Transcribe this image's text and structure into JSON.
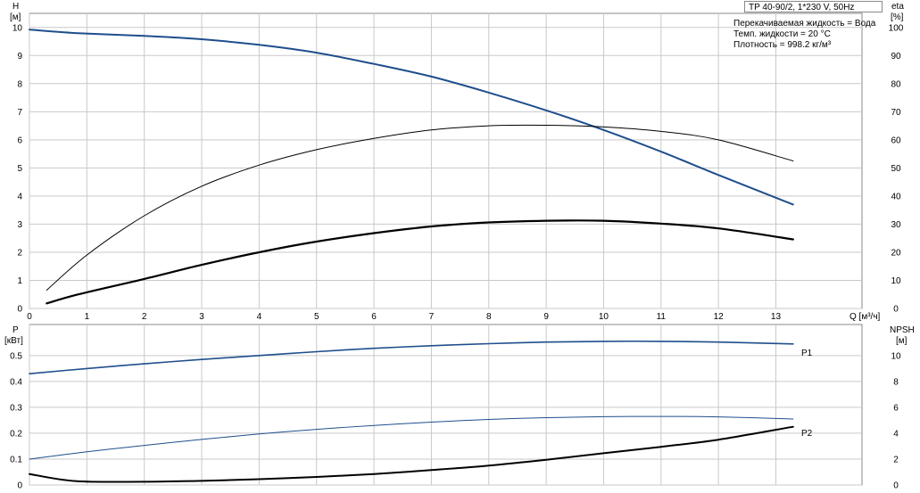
{
  "header": {
    "pump_model": "TP 40-90/2, 1*230 V, 50Hz",
    "info_lines": [
      "Перекачиваемая жидкость = Вода",
      "Темп. жидкости = 20 °C",
      "Плотность = 998.2 кг/м³"
    ]
  },
  "chart_data": [
    {
      "type": "line",
      "xlabel": "Q [м³/ч]",
      "xlim": [
        0,
        14.5
      ],
      "x_ticks": [
        0,
        1,
        2,
        3,
        4,
        5,
        6,
        7,
        8,
        9,
        10,
        11,
        12,
        13
      ],
      "left_axis": {
        "label_line1": "H",
        "label_line2": "[м]",
        "ylim": [
          0,
          10.5
        ],
        "ticks": [
          0,
          1,
          2,
          3,
          4,
          5,
          6,
          7,
          8,
          9,
          10
        ]
      },
      "right_axis": {
        "label_line1": "eta",
        "label_line2": "[%]",
        "ylim": [
          0,
          105
        ],
        "ticks": [
          0,
          10,
          20,
          30,
          40,
          50,
          60,
          70,
          80,
          90,
          100
        ]
      },
      "grid": true,
      "series": [
        {
          "id": "H",
          "axis": "left",
          "color": "#1f4e8c",
          "width": 2,
          "x": [
            0,
            0.8,
            2,
            3,
            4,
            5,
            6,
            7,
            8,
            9,
            10,
            11,
            12,
            13.3
          ],
          "y": [
            9.92,
            9.8,
            9.7,
            9.58,
            9.38,
            9.1,
            8.7,
            8.25,
            7.68,
            7.05,
            6.35,
            5.58,
            4.75,
            3.7
          ]
        },
        {
          "id": "eta_total",
          "axis": "right",
          "color": "#000000",
          "width": 1,
          "x": [
            0.3,
            1,
            2,
            3,
            4,
            5,
            6,
            7,
            8,
            9,
            10,
            11,
            12,
            13.3
          ],
          "y": [
            6.5,
            19,
            33,
            43.5,
            51,
            56.5,
            60.5,
            63.5,
            65,
            65.2,
            64.6,
            63,
            60,
            52.5
          ]
        },
        {
          "id": "eta_pump",
          "axis": "right",
          "color": "#000000",
          "width": 2.2,
          "x": [
            0.3,
            0.85,
            2,
            3,
            4,
            5,
            6,
            7,
            8,
            9,
            10,
            11,
            12,
            13.3
          ],
          "y": [
            1.8,
            5,
            10.5,
            15.5,
            20,
            23.8,
            26.8,
            29.2,
            30.6,
            31.2,
            31.2,
            30.2,
            28.5,
            24.6
          ]
        }
      ]
    },
    {
      "type": "line",
      "xlim": [
        0,
        14.5
      ],
      "left_axis": {
        "label_line1": "P",
        "label_line2": "[кВт]",
        "ylim": [
          0,
          0.62
        ],
        "ticks": [
          0,
          0.1,
          0.2,
          0.3,
          0.4,
          0.5
        ]
      },
      "right_axis": {
        "label_line1": "NPSH",
        "label_line2": "[м]",
        "ylim": [
          0,
          12.4
        ],
        "ticks": [
          0,
          2,
          4,
          6,
          8,
          10
        ]
      },
      "grid": true,
      "series": [
        {
          "id": "P1",
          "name": "P1",
          "axis": "left",
          "color": "#1f4e8c",
          "width": 1.6,
          "x": [
            0,
            1,
            2,
            3,
            4,
            5,
            6,
            7,
            8,
            9,
            10,
            11,
            12,
            13.3
          ],
          "y": [
            0.43,
            0.45,
            0.468,
            0.485,
            0.5,
            0.515,
            0.528,
            0.538,
            0.546,
            0.552,
            0.555,
            0.555,
            0.552,
            0.545
          ]
        },
        {
          "id": "P2",
          "name": "P2",
          "axis": "left",
          "color": "#1f4e8c",
          "width": 1,
          "x": [
            0,
            1,
            2,
            3,
            4,
            5,
            6,
            7,
            8,
            9,
            10,
            11,
            12,
            13.3
          ],
          "y": [
            0.1,
            0.128,
            0.153,
            0.176,
            0.197,
            0.215,
            0.23,
            0.243,
            0.253,
            0.26,
            0.264,
            0.265,
            0.263,
            0.255
          ]
        },
        {
          "id": "NPSH",
          "axis": "right",
          "color": "#000000",
          "width": 2,
          "x": [
            0,
            0.8,
            2,
            3,
            4,
            5,
            6,
            7,
            8,
            9,
            10,
            11,
            12,
            13.3
          ],
          "y": [
            0.85,
            0.3,
            0.25,
            0.32,
            0.45,
            0.62,
            0.85,
            1.15,
            1.5,
            1.95,
            2.45,
            2.95,
            3.5,
            4.5
          ]
        }
      ]
    }
  ]
}
